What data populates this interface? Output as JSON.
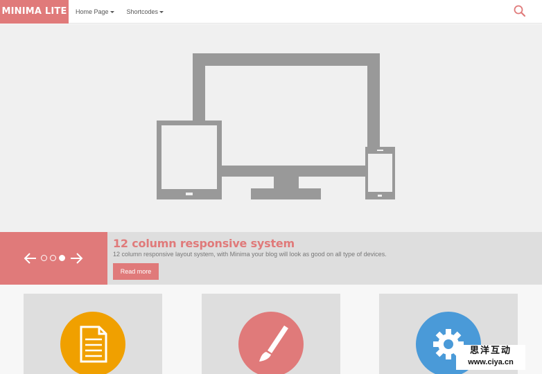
{
  "header": {
    "logo": "MINIMA LITE",
    "nav": [
      {
        "label": "Home Page",
        "has_dropdown": true
      },
      {
        "label": "Shortcodes",
        "has_dropdown": true
      }
    ],
    "search_icon": "search-icon"
  },
  "hero": {
    "illustration": "responsive-devices-icon"
  },
  "slider": {
    "title": "12 column responsive system",
    "description": "12 column responsive layout system, with Minima your blog will look as good on all type of devices.",
    "button_label": "Read more",
    "total_slides": 3,
    "active_slide": 3
  },
  "features": [
    {
      "icon": "document-icon",
      "color": "#f0a000"
    },
    {
      "icon": "paintbrush-icon",
      "color": "#e07a7a"
    },
    {
      "icon": "gear-icon",
      "color": "#4a9ad8"
    }
  ],
  "watermark": {
    "text": "思洋互动",
    "url": "www.ciya.cn"
  },
  "colors": {
    "accent": "#e07a7a",
    "hero_bg": "#f0f0f0",
    "device_gray": "#999999",
    "box_bg": "#dedede"
  }
}
